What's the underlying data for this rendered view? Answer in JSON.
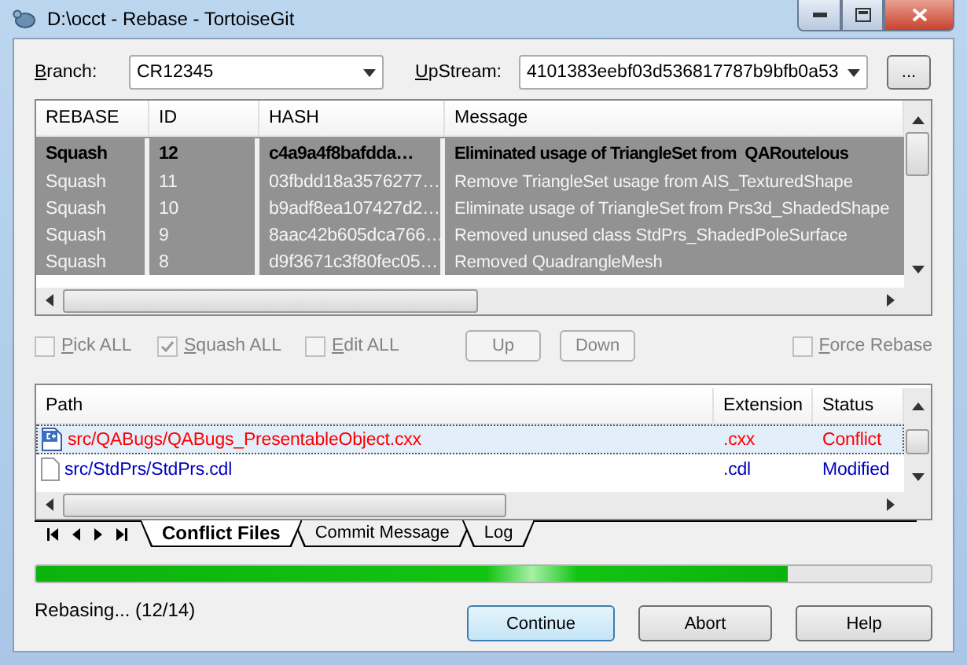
{
  "window": {
    "title": "D:\\occt - Rebase - TortoiseGit"
  },
  "branch": {
    "label": "Branch:",
    "value": "CR12345"
  },
  "upstream": {
    "label": "UpStream:",
    "value": "4101383eebf03d536817787b9bfb0a53",
    "browse": "..."
  },
  "commits": {
    "columns": [
      "REBASE",
      "ID",
      "HASH",
      "Message"
    ],
    "rows": [
      {
        "action": "Squash",
        "id": "12",
        "hash": "c4a9a4f8bafdda…",
        "message": "Eliminated usage of TriangleSet from  QARoutelous",
        "selected": true
      },
      {
        "action": "Squash",
        "id": "11",
        "hash": "03fbdd18a3576277…",
        "message": "Remove TriangleSet usage from AIS_TexturedShape",
        "selected": false
      },
      {
        "action": "Squash",
        "id": "10",
        "hash": "b9adf8ea107427d2…",
        "message": "Eliminate usage of TriangleSet from Prs3d_ShadedShape",
        "selected": false
      },
      {
        "action": "Squash",
        "id": "9",
        "hash": "8aac42b605dca766…",
        "message": "Removed unused class StdPrs_ShadedPoleSurface",
        "selected": false
      },
      {
        "action": "Squash",
        "id": "8",
        "hash": "d9f3671c3f80fec05…",
        "message": "Removed QuadrangleMesh",
        "selected": false
      }
    ]
  },
  "options": [
    {
      "label": "Pick ALL",
      "checked": false
    },
    {
      "label": "Squash ALL",
      "checked": true
    },
    {
      "label": "Edit ALL",
      "checked": false
    }
  ],
  "move_buttons": [
    "Up",
    "Down"
  ],
  "force_rebase": {
    "label": "Force Rebase",
    "checked": false
  },
  "files": {
    "columns": [
      "Path",
      "Extension",
      "Status"
    ],
    "rows": [
      {
        "kind": "cpp",
        "path": "src/QABugs/QABugs_PresentableObject.cxx",
        "extension": ".cxx",
        "status": "Conflict",
        "color": "#ff0000",
        "selected": true
      },
      {
        "kind": "file",
        "path": "src/StdPrs/StdPrs.cdl",
        "extension": ".cdl",
        "status": "Modified",
        "color": "#0000c0",
        "selected": false
      }
    ]
  },
  "tabs": [
    {
      "label": "Conflict Files",
      "selected": true
    },
    {
      "label": "Commit Message",
      "selected": false
    },
    {
      "label": "Log",
      "selected": false
    }
  ],
  "progress": {
    "level": 0.84
  },
  "status": "Rebasing... (12/14)",
  "buttons": [
    {
      "label": "Continue",
      "default": true
    },
    {
      "label": "Abort",
      "default": false
    },
    {
      "label": "Help",
      "default": false
    }
  ]
}
